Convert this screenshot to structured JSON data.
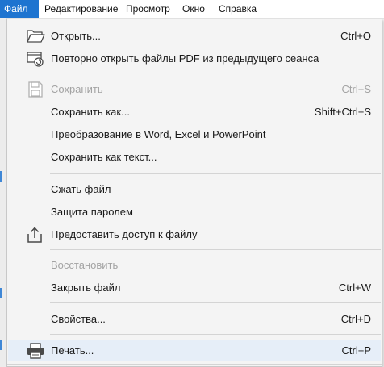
{
  "menubar": {
    "items": [
      {
        "label": "Файл",
        "active": true
      },
      {
        "label": "Редактирование",
        "active": false
      },
      {
        "label": "Просмотр",
        "active": false
      },
      {
        "label": "Окно",
        "active": false
      },
      {
        "label": "Справка",
        "active": false
      }
    ]
  },
  "menu": {
    "open": {
      "label": "Открыть...",
      "shortcut": "Ctrl+O",
      "icon": "folder-open-icon"
    },
    "reopen": {
      "label": "Повторно открыть файлы PDF из предыдущего сеанса",
      "icon": "reopen-session-icon"
    },
    "save": {
      "label": "Сохранить",
      "shortcut": "Ctrl+S",
      "icon": "save-disk-icon",
      "disabled": true
    },
    "save_as": {
      "label": "Сохранить как...",
      "shortcut": "Shift+Ctrl+S"
    },
    "convert": {
      "label": "Преобразование в Word, Excel и PowerPoint"
    },
    "save_text": {
      "label": "Сохранить как текст..."
    },
    "compress": {
      "label": "Сжать файл"
    },
    "protect": {
      "label": "Защита паролем"
    },
    "share": {
      "label": "Предоставить доступ к файлу",
      "icon": "share-icon"
    },
    "restore": {
      "label": "Восстановить",
      "disabled": true
    },
    "close": {
      "label": "Закрыть файл",
      "shortcut": "Ctrl+W"
    },
    "properties": {
      "label": "Свойства...",
      "shortcut": "Ctrl+D"
    },
    "print": {
      "label": "Печать...",
      "shortcut": "Ctrl+P",
      "icon": "printer-icon",
      "hovered": true
    }
  },
  "colors": {
    "accent": "#1e74d0",
    "hover": "#e6eef8",
    "disabled_text": "#a3a3a3",
    "menu_bg": "#f4f4f4"
  }
}
